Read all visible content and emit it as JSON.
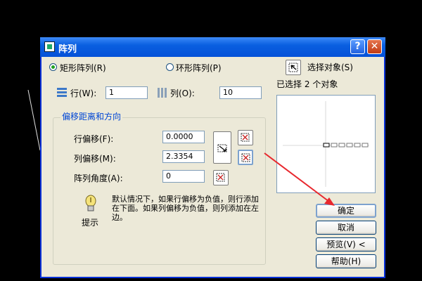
{
  "dialog": {
    "title": "阵列",
    "help_label": "?",
    "close_label": "✕"
  },
  "array_type": {
    "rect_label": "矩形阵列(R)",
    "polar_label": "环形阵列(P)",
    "selected": "rect"
  },
  "select_objects": {
    "button_label": "选择对象(S)",
    "status_prefix": "已选择",
    "count": "2",
    "status_suffix": "个对象"
  },
  "rows": {
    "label": "行(W):",
    "value": "1"
  },
  "columns": {
    "label": "列(O):",
    "value": "10"
  },
  "offset_group": {
    "title": "偏移距离和方向",
    "row_offset_label": "行偏移(F):",
    "row_offset_value": "0.0000",
    "col_offset_label": "列偏移(M):",
    "col_offset_value": "2.3354",
    "angle_label": "阵列角度(A):",
    "angle_value": "0"
  },
  "hint": {
    "caption": "提示",
    "text": "默认情况下，如果行偏移为负值，则行添加在下面。如果列偏移为负值，则列添加在左边。"
  },
  "buttons": {
    "ok": "确定",
    "cancel": "取消",
    "preview": "预览(V) <",
    "help": "帮助(H)"
  },
  "colors": {
    "titlebar": "#0a5fe0",
    "dialog_bg": "#ece9d8",
    "group_title": "#0046d5",
    "annotation_arrow": "#e8282e"
  },
  "icons": {
    "title": "array-app-icon",
    "select": "select-objects-icon",
    "rows": "rows-icon",
    "columns": "columns-icon",
    "pick_both": "pick-both-offsets-icon",
    "pick_row": "pick-row-offset-icon",
    "pick_col": "pick-column-offset-icon",
    "pick_angle": "pick-angle-icon",
    "hint": "lightbulb-icon"
  }
}
